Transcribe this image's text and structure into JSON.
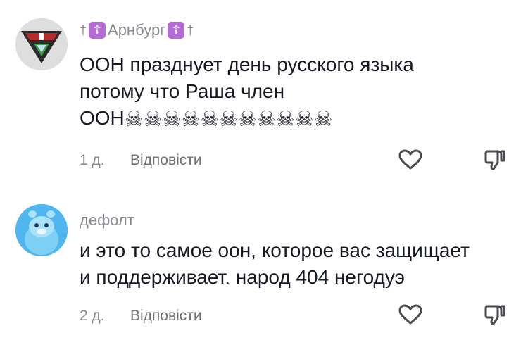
{
  "comments": [
    {
      "username_prefix": "†",
      "badge_symbol": "☦",
      "username": "Арнбург",
      "username_suffix": "†",
      "text_lines": [
        "ООН празднует день русского языка",
        "потому что Раша член",
        "ООН"
      ],
      "skulls": "☠☠☠☠☠☠☠☠☠☠☠",
      "time": "1 д.",
      "reply_label": "Відповісти",
      "avatar_icon": "red-triangle-flag-avatar",
      "like_icon": "heart-outline-icon",
      "dislike_icon": "thumbs-down-icon"
    },
    {
      "username": "дефолт",
      "text_lines": [
        "и это то самое оон, которое вас защищает",
        "и поддерживает. народ 404 негодуэ"
      ],
      "time": "2 д.",
      "reply_label": "Відповісти",
      "avatar_icon": "blue-cartoon-character-avatar",
      "like_icon": "heart-outline-icon",
      "dislike_icon": "thumbs-down-icon"
    }
  ],
  "colors": {
    "text": "#161823",
    "muted": "#8a8b91",
    "badge": "#b56bd6",
    "avatar2_bg": "#4fb6ef"
  }
}
